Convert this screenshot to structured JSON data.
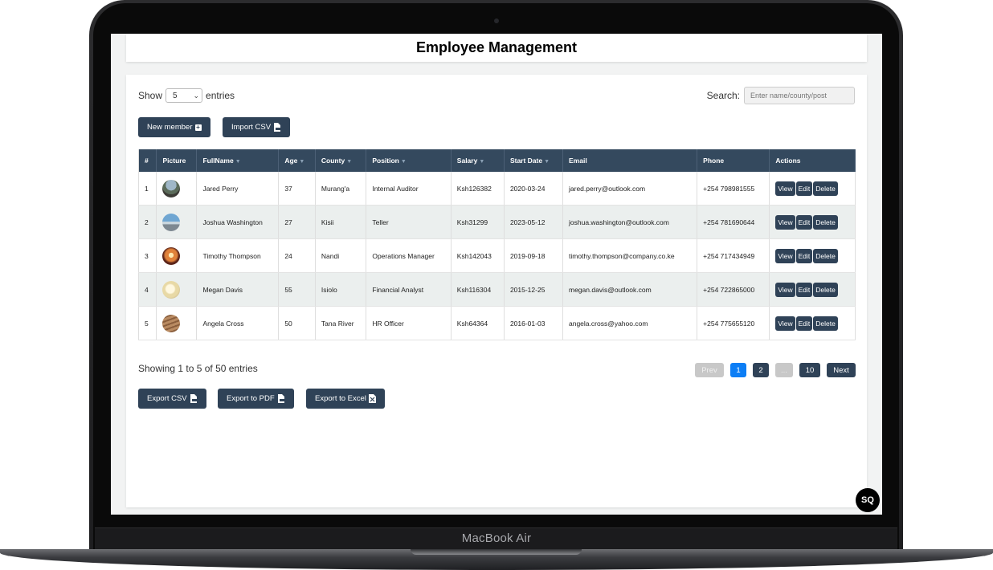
{
  "device": {
    "brand": "MacBook Air"
  },
  "app": {
    "title": "Employee Management"
  },
  "controls": {
    "show_label": "Show",
    "entries_value": "5",
    "entries_label": "entries",
    "search_label": "Search:",
    "search_placeholder": "Enter name/county/post",
    "new_member_label": "New member",
    "import_csv_label": "Import CSV"
  },
  "table": {
    "headers": [
      "#",
      "Picture",
      "FullName",
      "Age",
      "County",
      "Position",
      "Salary",
      "Start Date",
      "Email",
      "Phone",
      "Actions"
    ],
    "rows": [
      {
        "num": "1",
        "name": "Jared Perry",
        "age": "37",
        "county": "Murang'a",
        "position": "Internal Auditor",
        "salary": "Ksh126382",
        "start": "2020-03-24",
        "email": "jared.perry@outlook.com",
        "phone": "+254 798981555"
      },
      {
        "num": "2",
        "name": "Joshua Washington",
        "age": "27",
        "county": "Kisii",
        "position": "Teller",
        "salary": "Ksh31299",
        "start": "2023-05-12",
        "email": "joshua.washington@outlook.com",
        "phone": "+254 781690644"
      },
      {
        "num": "3",
        "name": "Timothy Thompson",
        "age": "24",
        "county": "Nandi",
        "position": "Operations Manager",
        "salary": "Ksh142043",
        "start": "2019-09-18",
        "email": "timothy.thompson@company.co.ke",
        "phone": "+254 717434949"
      },
      {
        "num": "4",
        "name": "Megan Davis",
        "age": "55",
        "county": "Isiolo",
        "position": "Financial Analyst",
        "salary": "Ksh116304",
        "start": "2015-12-25",
        "email": "megan.davis@outlook.com",
        "phone": "+254 722865000"
      },
      {
        "num": "5",
        "name": "Angela Cross",
        "age": "50",
        "county": "Tana River",
        "position": "HR Officer",
        "salary": "Ksh64364",
        "start": "2016-01-03",
        "email": "angela.cross@yahoo.com",
        "phone": "+254 775655120"
      }
    ],
    "actions": {
      "view": "View",
      "edit": "Edit",
      "delete": "Delete"
    }
  },
  "footer": {
    "showing": "Showing 1 to 5 of 50 entries",
    "pagination": {
      "prev": "Prev",
      "p1": "1",
      "p2": "2",
      "ellipsis": "...",
      "p10": "10",
      "next": "Next"
    },
    "export_csv": "Export CSV",
    "export_pdf": "Export to PDF",
    "export_excel": "Export to Excel"
  },
  "fab": {
    "label": "SQ"
  },
  "colors": {
    "primary": "#2f4257",
    "header": "#34495e",
    "active_page": "#0d7ef5",
    "alt_row": "#ebefee"
  }
}
